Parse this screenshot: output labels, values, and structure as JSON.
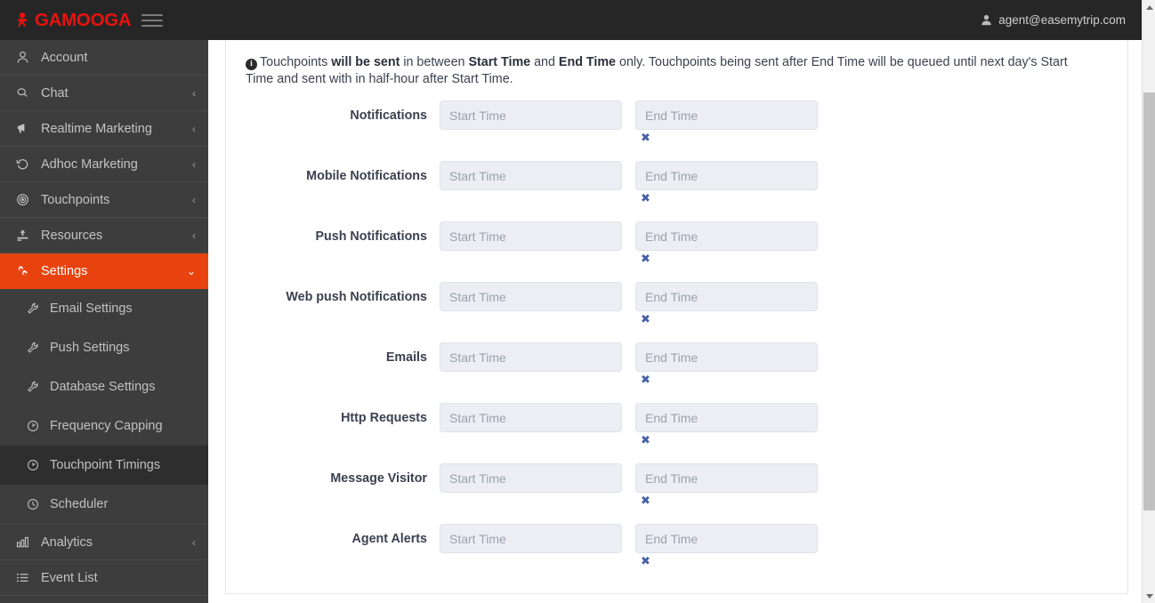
{
  "topbar": {
    "brand": "GAMOOGA",
    "brand_color": "#e8120f",
    "menu_icon": "hamburger-icon",
    "user_icon": "user-icon",
    "user_email": "agent@easemytrip.com"
  },
  "sidebar": {
    "active_color": "#e8430f",
    "items": [
      {
        "label": "Account",
        "icon": "user-icon",
        "caret": "",
        "active": false
      },
      {
        "label": "Chat",
        "icon": "chat-icon",
        "caret": "‹",
        "active": false
      },
      {
        "label": "Realtime Marketing",
        "icon": "megaphone-icon",
        "caret": "‹",
        "active": false
      },
      {
        "label": "Adhoc Marketing",
        "icon": "history-icon",
        "caret": "‹",
        "active": false
      },
      {
        "label": "Touchpoints",
        "icon": "target-icon",
        "caret": "‹",
        "active": false
      },
      {
        "label": "Resources",
        "icon": "upload-icon",
        "caret": "‹",
        "active": false
      },
      {
        "label": "Settings",
        "icon": "gears-icon",
        "caret": "⌄",
        "active": true
      }
    ],
    "subitems": [
      {
        "label": "Email Settings",
        "icon": "wrench-icon",
        "selected": false
      },
      {
        "label": "Push Settings",
        "icon": "wrench-icon",
        "selected": false
      },
      {
        "label": "Database Settings",
        "icon": "wrench-icon",
        "selected": false
      },
      {
        "label": "Frequency Capping",
        "icon": "clock-arrow-icon",
        "selected": false
      },
      {
        "label": "Touchpoint Timings",
        "icon": "clock-arrow-icon",
        "selected": true
      },
      {
        "label": "Scheduler",
        "icon": "clock-icon",
        "selected": false
      }
    ],
    "items_after": [
      {
        "label": "Analytics",
        "icon": "bar-chart-icon",
        "caret": "‹"
      },
      {
        "label": "Event List",
        "icon": "list-icon",
        "caret": ""
      }
    ]
  },
  "banner": {
    "info_icon": "info-icon",
    "p1_a": "Touchpoints ",
    "p1_b": "will be sent",
    "p1_c": " in between ",
    "p1_d": "Start Time",
    "p1_e": " and ",
    "p1_f": "End Time",
    "p1_g": " only. Touchpoints being sent after End Time will be queued until next day's Start Time and sent with in half-hour after Start Time."
  },
  "form": {
    "start_placeholder": "Start Time",
    "end_placeholder": "End Time",
    "clear_icon": "clear-x-icon",
    "clear_icon_glyph": "✖",
    "clear_icon_color": "#4360a8",
    "rows": [
      {
        "label": "Notifications",
        "start_value": "",
        "end_value": "",
        "has_clear": true
      },
      {
        "label": "Mobile Notifications",
        "start_value": "",
        "end_value": "",
        "has_clear": true
      },
      {
        "label": "Push Notifications",
        "start_value": "",
        "end_value": "",
        "has_clear": true
      },
      {
        "label": "Web push Notifications",
        "start_value": "",
        "end_value": "",
        "has_clear": true
      },
      {
        "label": "Emails",
        "start_value": "",
        "end_value": "",
        "has_clear": true
      },
      {
        "label": "Http Requests",
        "start_value": "",
        "end_value": "",
        "has_clear": true
      },
      {
        "label": "Message Visitor",
        "start_value": "",
        "end_value": "",
        "has_clear": true
      },
      {
        "label": "Agent Alerts",
        "start_value": "",
        "end_value": "",
        "has_clear": true
      }
    ]
  },
  "scrollbar": {
    "up_icon": "scroll-up-arrow-icon",
    "down_icon": "scroll-down-arrow-icon"
  }
}
